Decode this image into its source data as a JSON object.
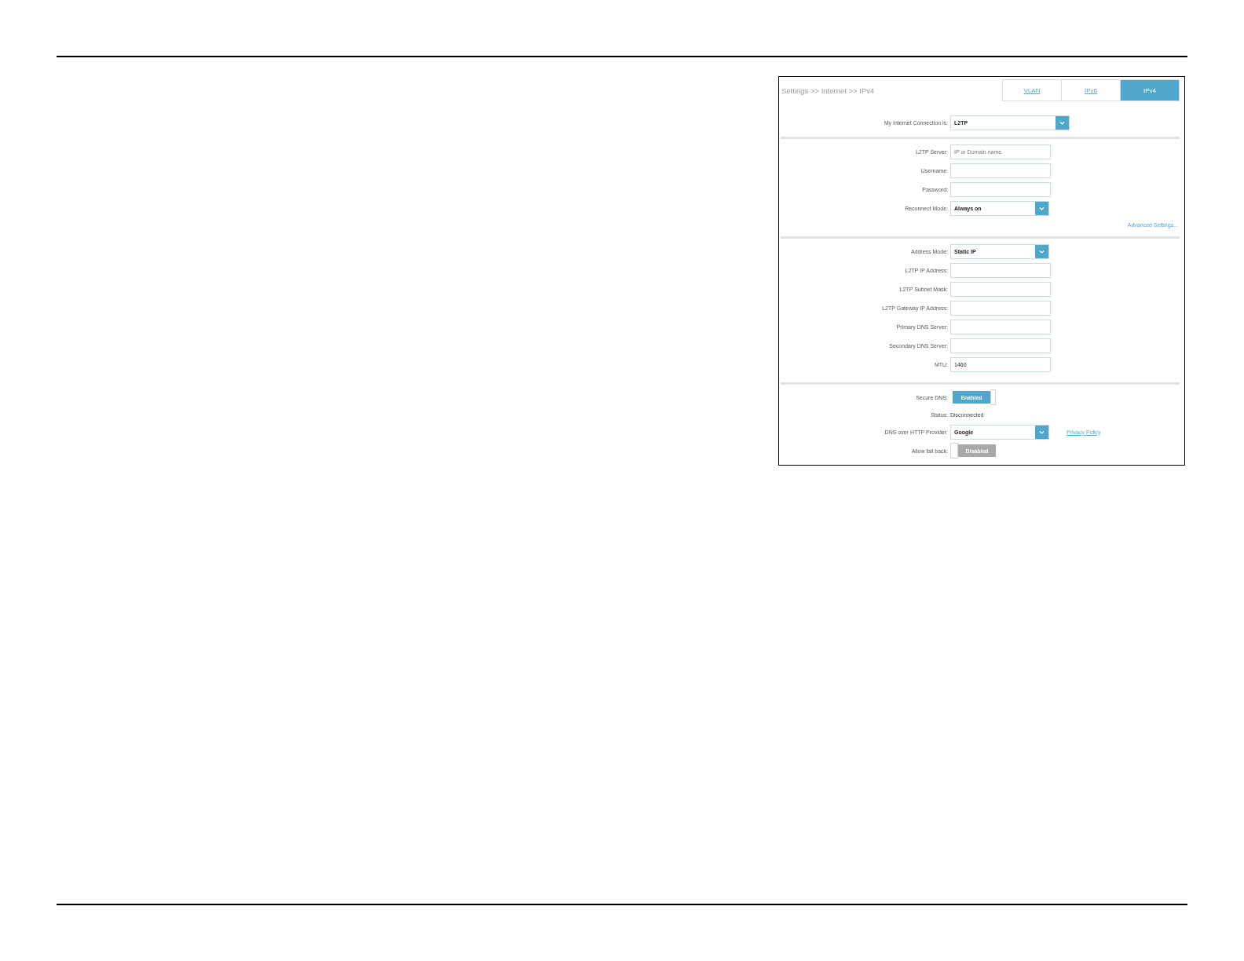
{
  "panel": {
    "breadcrumb": "Settings >> Internet >> IPv4",
    "tabs": [
      {
        "label": "VLAN",
        "selected": false
      },
      {
        "label": "IPv6",
        "selected": false
      },
      {
        "label": "IPv4",
        "selected": true
      }
    ]
  },
  "connection": {
    "label": "My Internet Connection is:",
    "value": "L2TP"
  },
  "sections": [
    {
      "fields": [
        {
          "kind": "input",
          "label": "L2TP Server:",
          "placeholder": "IP or Domain name"
        },
        {
          "kind": "input",
          "label": "Username:"
        },
        {
          "kind": "input",
          "label": "Password:"
        },
        {
          "kind": "select",
          "label": "Reconnect Mode:",
          "value": "Always on"
        }
      ],
      "link": "Advanced Settings..."
    },
    {
      "fields": [
        {
          "kind": "select",
          "label": "Address Mode:",
          "value": "Static IP"
        },
        {
          "kind": "input",
          "label": "L2TP IP Address:"
        },
        {
          "kind": "input",
          "label": "L2TP Subnet Mask:"
        },
        {
          "kind": "input",
          "label": "L2TP Gateway IP Address:"
        },
        {
          "kind": "input",
          "label": "Primary DNS Server:"
        },
        {
          "kind": "input",
          "label": "Secondary DNS Server:"
        },
        {
          "kind": "input",
          "label": "MTU:",
          "value": "1460"
        }
      ]
    },
    {
      "fields": [
        {
          "kind": "toggle",
          "label": "Secure DNS:",
          "on": true,
          "value": "Enabled"
        },
        {
          "kind": "text",
          "label": "Status:",
          "value": "Disconnected"
        },
        {
          "kind": "select",
          "label": "DNS over HTTP Provider:",
          "value": "Google",
          "link": "Privacy Policy"
        },
        {
          "kind": "toggle",
          "label": "Allow fall back:",
          "on": false,
          "value": "Disabled"
        }
      ]
    }
  ]
}
